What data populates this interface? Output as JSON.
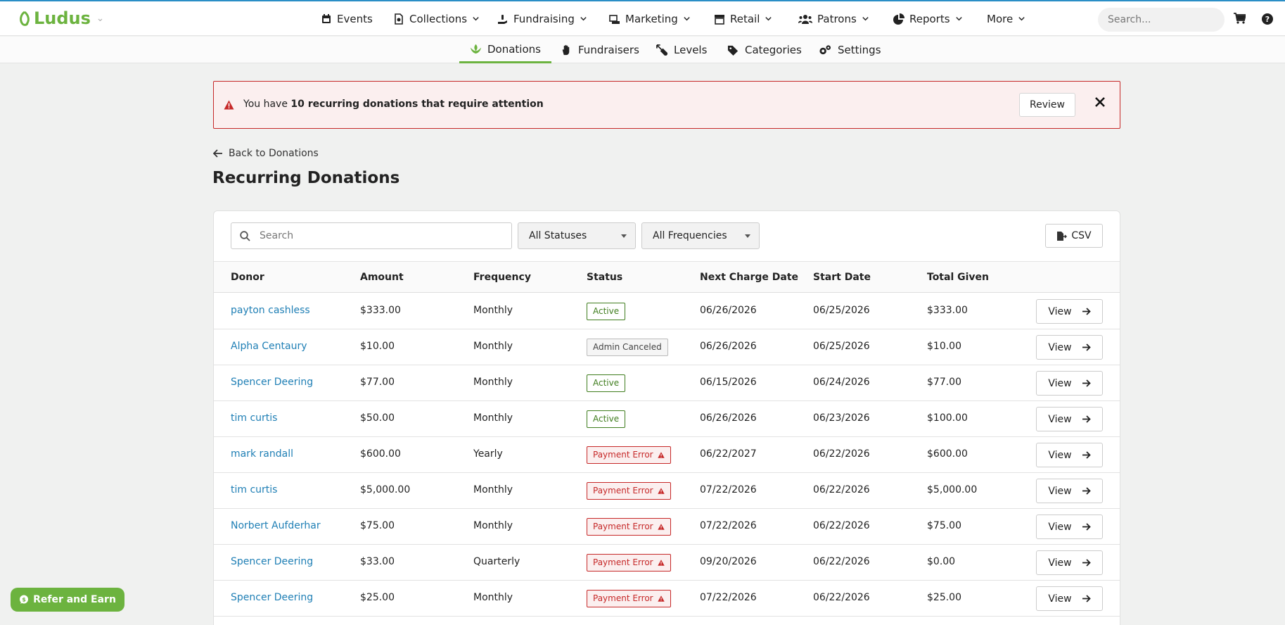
{
  "brand": {
    "name": "Ludus"
  },
  "nav": {
    "items": [
      {
        "label": "Events",
        "icon": "calendar-icon"
      },
      {
        "label": "Collections",
        "icon": "collections-icon"
      },
      {
        "label": "Fundraising",
        "icon": "fundraising-icon"
      },
      {
        "label": "Marketing",
        "icon": "marketing-icon"
      },
      {
        "label": "Retail",
        "icon": "store-icon"
      },
      {
        "label": "Patrons",
        "icon": "users-icon"
      },
      {
        "label": "Reports",
        "icon": "pie-chart-icon"
      },
      {
        "label": "More",
        "icon": ""
      }
    ],
    "search_placeholder": "Search..."
  },
  "subnav": {
    "tabs": [
      {
        "label": "Donations",
        "icon": "donation-icon",
        "active": true
      },
      {
        "label": "Fundraisers",
        "icon": "hand-icon",
        "active": false
      },
      {
        "label": "Levels",
        "icon": "levels-icon",
        "active": false
      },
      {
        "label": "Categories",
        "icon": "tags-icon",
        "active": false
      },
      {
        "label": "Settings",
        "icon": "gears-icon",
        "active": false
      }
    ]
  },
  "alert": {
    "prefix": "You have ",
    "emphasis": "10 recurring donations that require attention",
    "button": "Review"
  },
  "back_link": "Back to Donations",
  "page_title": "Recurring Donations",
  "filters": {
    "search_placeholder": "Search",
    "status": "All Statuses",
    "frequency": "All Frequencies",
    "export": "CSV"
  },
  "table": {
    "columns": [
      "Donor",
      "Amount",
      "Frequency",
      "Status",
      "Next Charge Date",
      "Start Date",
      "Total Given"
    ],
    "view_label": "View",
    "rows": [
      {
        "donor": "payton cashless",
        "amount": "$333.00",
        "frequency": "Monthly",
        "status": "Active",
        "status_type": "active",
        "next": "06/26/2026",
        "start": "06/25/2026",
        "total": "$333.00"
      },
      {
        "donor": "Alpha Centaury",
        "amount": "$10.00",
        "frequency": "Monthly",
        "status": "Admin Canceled",
        "status_type": "canceled",
        "next": "06/26/2026",
        "start": "06/25/2026",
        "total": "$10.00"
      },
      {
        "donor": "Spencer Deering",
        "amount": "$77.00",
        "frequency": "Monthly",
        "status": "Active",
        "status_type": "active",
        "next": "06/15/2026",
        "start": "06/24/2026",
        "total": "$77.00"
      },
      {
        "donor": "tim curtis",
        "amount": "$50.00",
        "frequency": "Monthly",
        "status": "Active",
        "status_type": "active",
        "next": "06/26/2026",
        "start": "06/23/2026",
        "total": "$100.00"
      },
      {
        "donor": "mark randall",
        "amount": "$600.00",
        "frequency": "Yearly",
        "status": "Payment Error",
        "status_type": "error",
        "next": "06/22/2027",
        "start": "06/22/2026",
        "total": "$600.00"
      },
      {
        "donor": "tim curtis",
        "amount": "$5,000.00",
        "frequency": "Monthly",
        "status": "Payment Error",
        "status_type": "error",
        "next": "07/22/2026",
        "start": "06/22/2026",
        "total": "$5,000.00"
      },
      {
        "donor": "Norbert Aufderhar",
        "amount": "$75.00",
        "frequency": "Monthly",
        "status": "Payment Error",
        "status_type": "error",
        "next": "07/22/2026",
        "start": "06/22/2026",
        "total": "$75.00"
      },
      {
        "donor": "Spencer Deering",
        "amount": "$33.00",
        "frequency": "Quarterly",
        "status": "Payment Error",
        "status_type": "error",
        "next": "09/20/2026",
        "start": "06/22/2026",
        "total": "$0.00"
      },
      {
        "donor": "Spencer Deering",
        "amount": "$25.00",
        "frequency": "Monthly",
        "status": "Payment Error",
        "status_type": "error",
        "next": "07/22/2026",
        "start": "06/22/2026",
        "total": "$25.00"
      }
    ]
  },
  "refer_button": "Refer and Earn",
  "colors": {
    "brand_green": "#6cb33f",
    "link_blue": "#1f7fb5",
    "error_red": "#c62828",
    "active_green": "#3f7d1e"
  }
}
